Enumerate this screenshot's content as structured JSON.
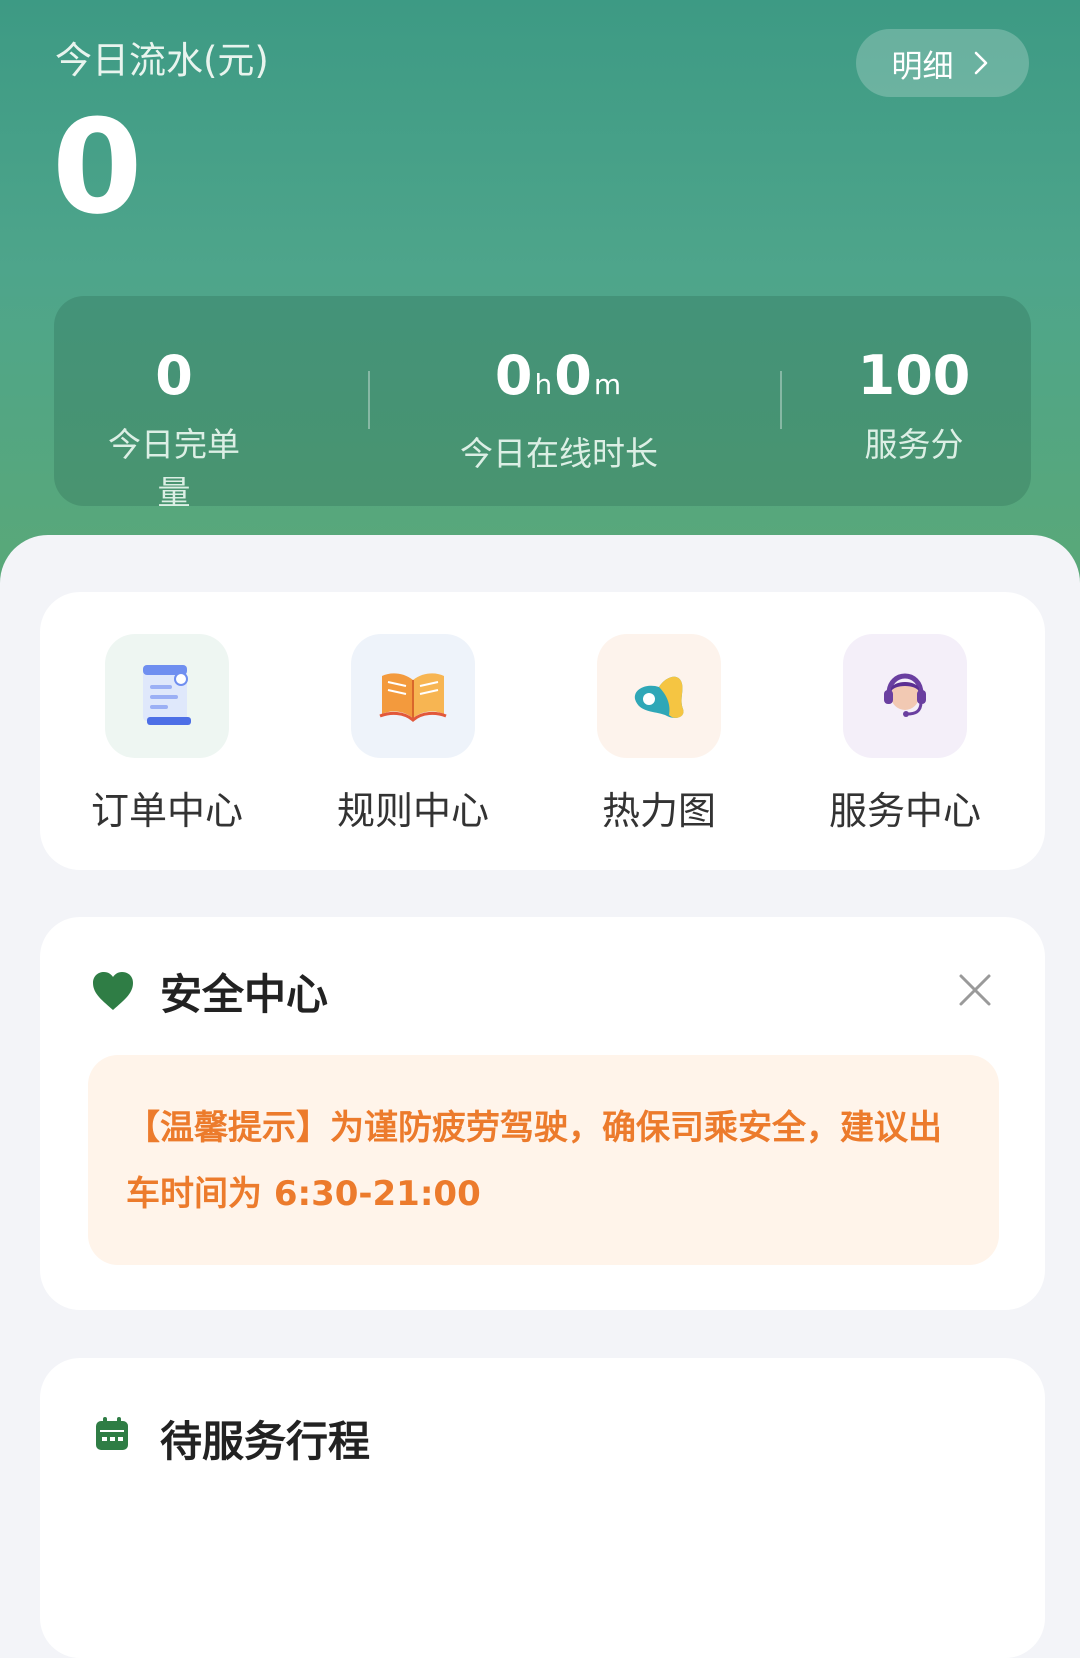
{
  "header": {
    "earnings_label": "今日流水(元)",
    "earnings_value": "0",
    "detail_button": "明细"
  },
  "stats": {
    "orders": {
      "value": "0",
      "label": "今日完单量"
    },
    "online": {
      "hours": "0",
      "hours_unit": "h",
      "minutes": "0",
      "minutes_unit": "m",
      "label": "今日在线时长"
    },
    "score": {
      "value": "100",
      "label": "服务分"
    }
  },
  "quick_actions": [
    {
      "label": "订单中心",
      "icon": "order-document-icon"
    },
    {
      "label": "规则中心",
      "icon": "open-book-icon"
    },
    {
      "label": "热力图",
      "icon": "heatmap-icon"
    },
    {
      "label": "服务中心",
      "icon": "customer-service-headset-icon"
    }
  ],
  "safety": {
    "title": "安全中心",
    "tip": "【温馨提示】为谨防疲劳驾驶，确保司乘安全，建议出车时间为 6:30-21:00"
  },
  "pending": {
    "title": "待服务行程"
  },
  "colors": {
    "brand_green": "#4ea58b",
    "heart_green": "#2f7d45",
    "tip_orange": "#ec7b2c",
    "tip_bg": "#fff4ea"
  }
}
